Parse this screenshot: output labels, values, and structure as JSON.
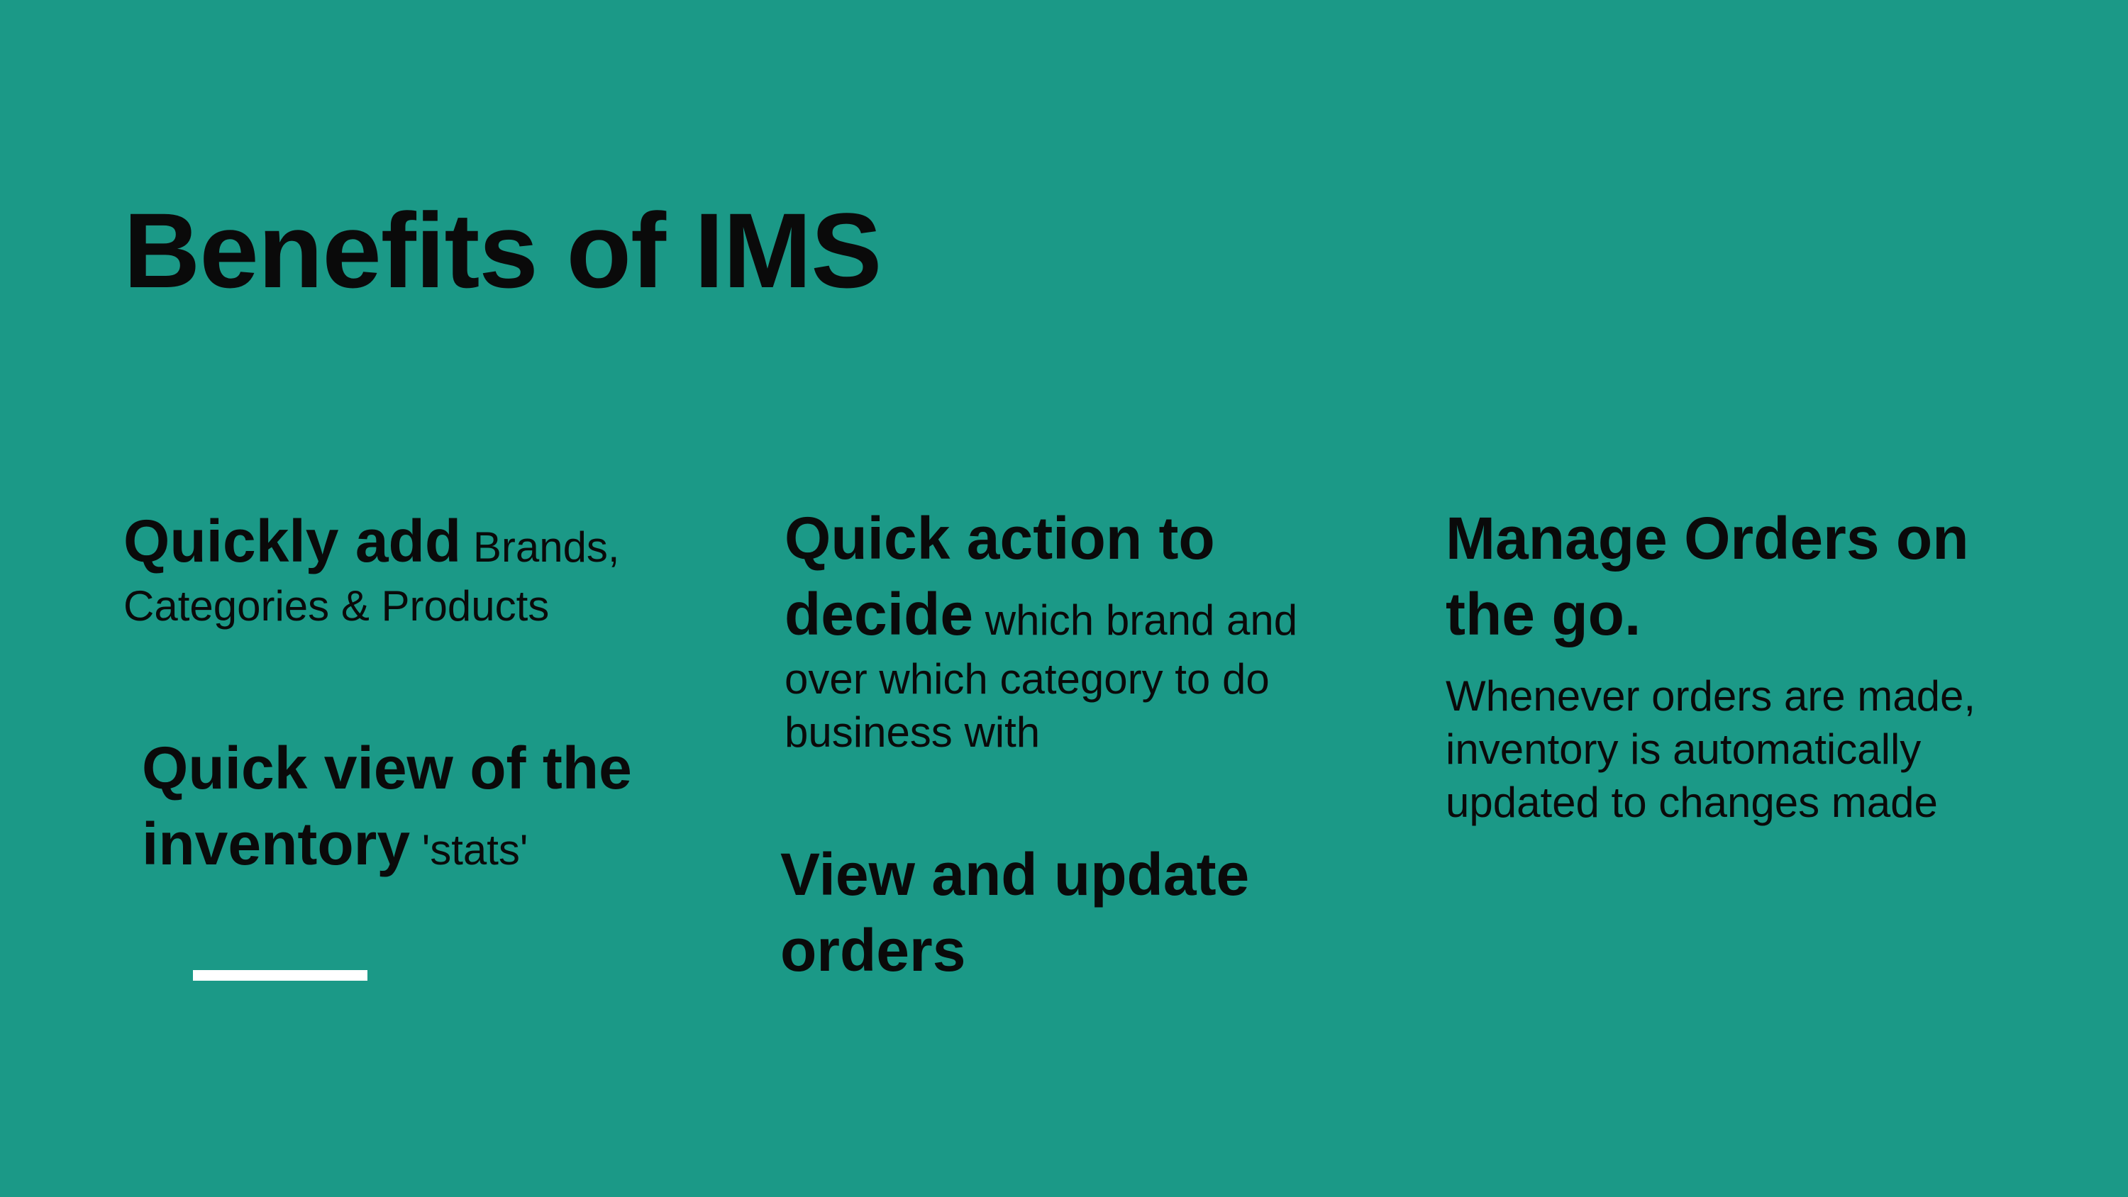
{
  "slide": {
    "title": "Benefits of IMS",
    "background_color": "#1b9987",
    "accent_bar_color": "#ffffff"
  },
  "benefits": {
    "quick_add": {
      "bold": "Quickly add",
      "rest": " Brands, Categories & Products"
    },
    "quick_view": {
      "bold": "Quick view of the inventory",
      "rest": " 'stats'"
    },
    "quick_action": {
      "bold": "Quick action to decide",
      "rest": " which brand and over which category to do business with"
    },
    "view_update": {
      "bold": "View and update orders"
    },
    "manage_orders": {
      "heading": "Manage Orders on the go.",
      "description": "Whenever orders are made, inventory is automatically updated to changes made"
    }
  }
}
